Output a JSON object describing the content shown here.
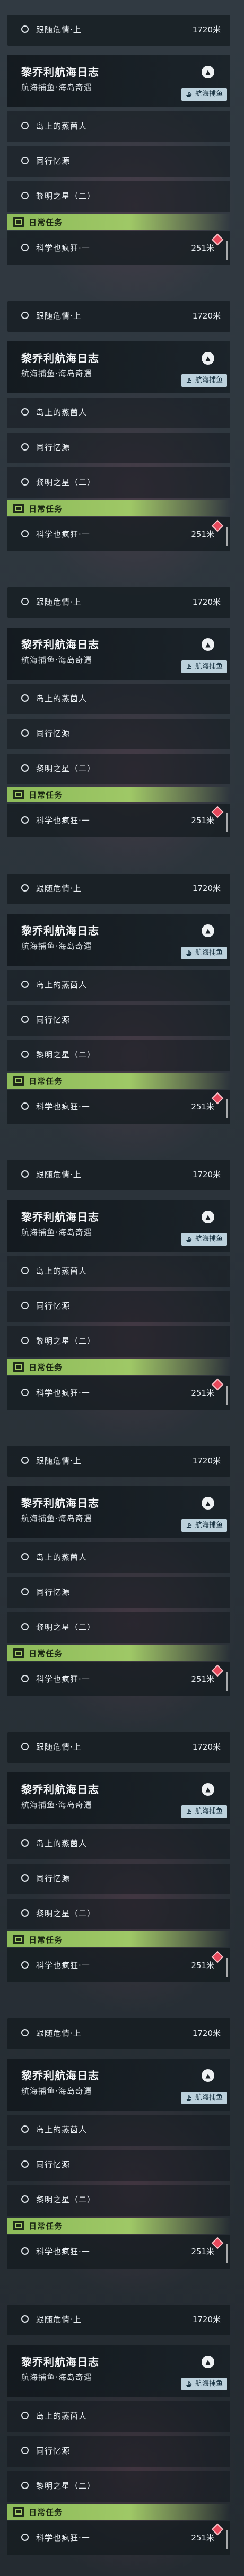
{
  "panels": [
    {
      "top_row": {
        "label": "跟随危情·上",
        "distance": "1720米"
      },
      "title": "黎乔利航海日志",
      "subtitle": "航海捕鱼·海岛奇遇",
      "badge": "航海捕鱼",
      "quests": [
        "岛上的蒸菌人",
        "同行忆源",
        "黎明之星（二）"
      ],
      "daily_label": "日常任务",
      "daily": {
        "label": "科学也疯狂·一",
        "distance": "251米"
      }
    },
    {
      "top_row": {
        "label": "跟随危情·上",
        "distance": "1720米"
      },
      "title": "黎乔利航海日志",
      "subtitle": "航海捕鱼·海岛奇遇",
      "badge": "航海捕鱼",
      "quests": [
        "岛上的蒸菌人",
        "同行忆源",
        "黎明之星（二）"
      ],
      "daily_label": "日常任务",
      "daily": {
        "label": "科学也疯狂·一",
        "distance": "251米"
      }
    },
    {
      "top_row": {
        "label": "跟随危情·上",
        "distance": "1720米"
      },
      "title": "黎乔利航海日志",
      "subtitle": "航海捕鱼·海岛奇遇",
      "badge": "航海捕鱼",
      "quests": [
        "岛上的蒸菌人",
        "同行忆源",
        "黎明之星（二）"
      ],
      "daily_label": "日常任务",
      "daily": {
        "label": "科学也疯狂·一",
        "distance": "251米"
      }
    },
    {
      "top_row": {
        "label": "跟随危情·上",
        "distance": "1720米"
      },
      "title": "黎乔利航海日志",
      "subtitle": "航海捕鱼·海岛奇遇",
      "badge": "航海捕鱼",
      "quests": [
        "岛上的蒸菌人",
        "同行忆源",
        "黎明之星（二）"
      ],
      "daily_label": "日常任务",
      "daily": {
        "label": "科学也疯狂·一",
        "distance": "251米"
      }
    },
    {
      "top_row": {
        "label": "跟随危情·上",
        "distance": "1720米"
      },
      "title": "黎乔利航海日志",
      "subtitle": "航海捕鱼·海岛奇遇",
      "badge": "航海捕鱼",
      "quests": [
        "岛上的蒸菌人",
        "同行忆源",
        "黎明之星（二）"
      ],
      "daily_label": "日常任务",
      "daily": {
        "label": "科学也疯狂·一",
        "distance": "251米"
      }
    },
    {
      "top_row": {
        "label": "跟随危情·上",
        "distance": "1720米"
      },
      "title": "黎乔利航海日志",
      "subtitle": "航海捕鱼·海岛奇遇",
      "badge": "航海捕鱼",
      "quests": [
        "岛上的蒸菌人",
        "同行忆源",
        "黎明之星（二）"
      ],
      "daily_label": "日常任务",
      "daily": {
        "label": "科学也疯狂·一",
        "distance": "251米"
      }
    },
    {
      "top_row": {
        "label": "跟随危情·上",
        "distance": "1720米"
      },
      "title": "黎乔利航海日志",
      "subtitle": "航海捕鱼·海岛奇遇",
      "badge": "航海捕鱼",
      "quests": [
        "岛上的蒸菌人",
        "同行忆源",
        "黎明之星（二）"
      ],
      "daily_label": "日常任务",
      "daily": {
        "label": "科学也疯狂·一",
        "distance": "251米"
      }
    },
    {
      "top_row": {
        "label": "跟随危情·上",
        "distance": "1720米"
      },
      "title": "黎乔利航海日志",
      "subtitle": "航海捕鱼·海岛奇遇",
      "badge": "航海捕鱼",
      "quests": [
        "岛上的蒸菌人",
        "同行忆源",
        "黎明之星（二）"
      ],
      "daily_label": "日常任务",
      "daily": {
        "label": "科学也疯狂·一",
        "distance": "251米"
      }
    },
    {
      "top_row": {
        "label": "跟随危情·上",
        "distance": "1720米"
      },
      "title": "黎乔利航海日志",
      "subtitle": "航海捕鱼·海岛奇遇",
      "badge": "航海捕鱼",
      "quests": [
        "岛上的蒸菌人",
        "同行忆源",
        "黎明之星（二）"
      ],
      "daily_label": "日常任务",
      "daily": {
        "label": "科学也疯狂·一",
        "distance": "251米"
      }
    }
  ],
  "icons": {
    "top_row": "circle-icon",
    "collapse": "chevron-up-icon",
    "badge": "ship-icon",
    "daily": "daily-task-icon",
    "marker": "map-marker-icon"
  },
  "colors": {
    "daily_bar": "#9fc866",
    "badge_bg": "#bcd1dc",
    "marker": "#e7485b"
  }
}
